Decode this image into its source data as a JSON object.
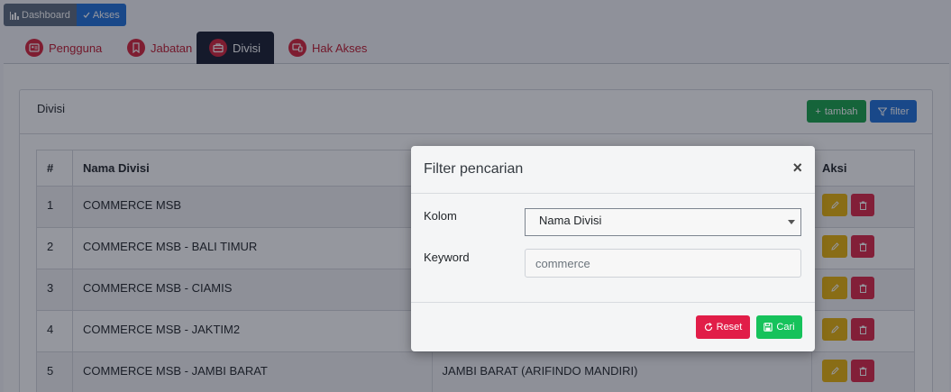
{
  "breadcrumb": {
    "items": [
      {
        "label": "Dashboard",
        "icon": "bar-chart-icon"
      },
      {
        "label": "Akses",
        "icon": "check-icon"
      }
    ]
  },
  "tabs": [
    {
      "label": "Pengguna",
      "icon": "user-card-icon",
      "active": false
    },
    {
      "label": "Jabatan",
      "icon": "bookmark-icon",
      "active": false
    },
    {
      "label": "Divisi",
      "icon": "briefcase-icon",
      "active": true
    },
    {
      "label": "Hak Akses",
      "icon": "devices-icon",
      "active": false
    }
  ],
  "card": {
    "title": "Divisi",
    "add_label": "tambah",
    "filter_label": "filter"
  },
  "table": {
    "headers": [
      "#",
      "Nama Divisi",
      "",
      "Aksi"
    ],
    "rows": [
      {
        "no": "1",
        "nama": "COMMERCE MSB",
        "col3": ""
      },
      {
        "no": "2",
        "nama": "COMMERCE MSB - BALI TIMUR",
        "col3": ""
      },
      {
        "no": "3",
        "nama": "COMMERCE MSB - CIAMIS",
        "col3": ""
      },
      {
        "no": "4",
        "nama": "COMMERCE MSB - JAKTIM2",
        "col3": ""
      },
      {
        "no": "5",
        "nama": "COMMERCE MSB - JAMBI BARAT",
        "col3": "JAMBI BARAT (ARIFINDO MANDIRI)"
      }
    ]
  },
  "modal": {
    "title": "Filter pencarian",
    "close": "×",
    "kolom_label": "Kolom",
    "kolom_value": "Nama Divisi",
    "keyword_label": "Keyword",
    "keyword_value": "",
    "keyword_placeholder": "commerce",
    "reset_label": "Reset",
    "cari_label": "Cari"
  },
  "colors": {
    "primary": "#1e6fd9",
    "success": "#16a34a",
    "danger": "#dc2646",
    "warning": "#eab308",
    "tab_active": "#161c2e",
    "tab_text": "#c0182e"
  }
}
